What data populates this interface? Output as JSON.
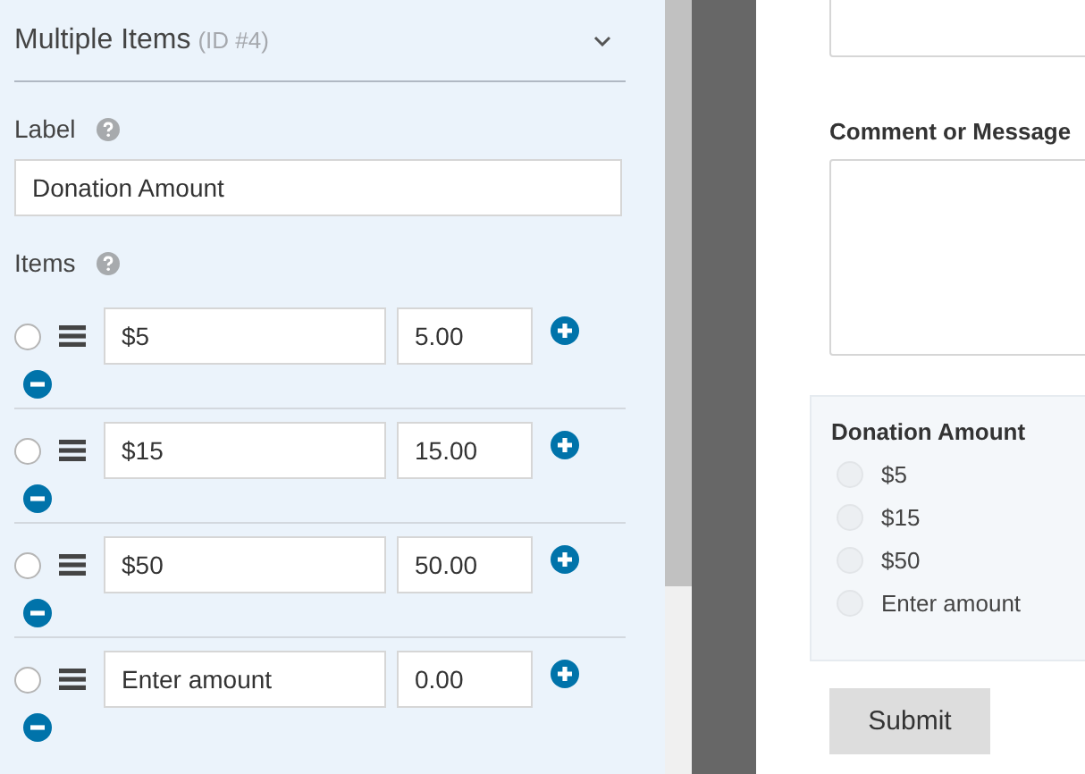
{
  "field_options": {
    "title": "Multiple Items",
    "id_label": "(ID #4)",
    "expanded": true,
    "label_caption": "Label",
    "label_value": "Donation Amount",
    "items_caption": "Items",
    "items": [
      {
        "label": "$5",
        "price": "5.00",
        "selected": false
      },
      {
        "label": "$15",
        "price": "15.00",
        "selected": false
      },
      {
        "label": "$50",
        "price": "50.00",
        "selected": false
      },
      {
        "label": "Enter amount",
        "price": "0.00",
        "selected": false
      }
    ]
  },
  "preview": {
    "comment_label": "Comment or Message",
    "donation_label": "Donation Amount",
    "choices": [
      {
        "label": "$5",
        "selected": false
      },
      {
        "label": "$15",
        "selected": false
      },
      {
        "label": "$50",
        "selected": false
      },
      {
        "label": "Enter amount",
        "selected": false
      }
    ],
    "submit": "Submit"
  }
}
